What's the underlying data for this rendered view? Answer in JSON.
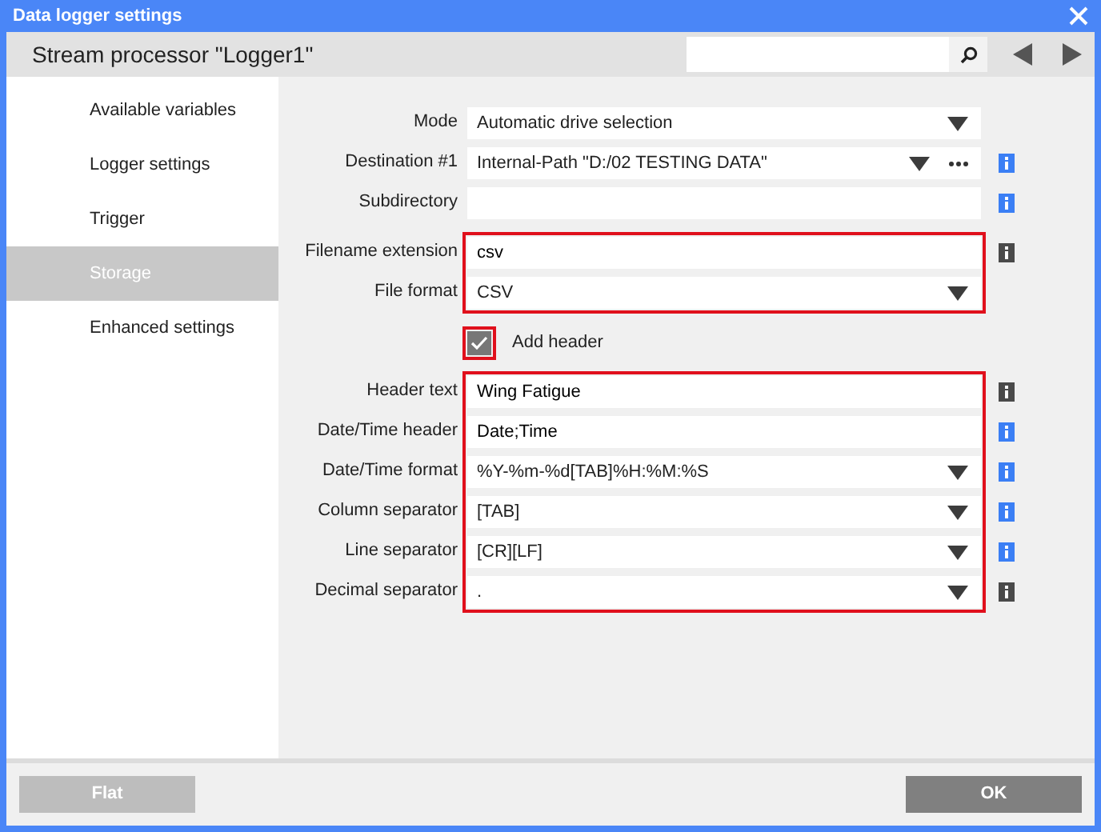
{
  "window": {
    "title": "Data logger settings"
  },
  "header": {
    "title": "Stream processor \"Logger1\""
  },
  "sidebar": {
    "items": [
      {
        "label": "Available variables",
        "selected": false
      },
      {
        "label": "Logger settings",
        "selected": false
      },
      {
        "label": "Trigger",
        "selected": false
      },
      {
        "label": "Storage",
        "selected": true
      },
      {
        "label": "Enhanced settings",
        "selected": false
      }
    ]
  },
  "form": {
    "groups": [
      {
        "rows": [
          {
            "kind": "select",
            "label": "Mode",
            "value": "Automatic drive selection"
          },
          {
            "kind": "browse",
            "label": "Destination #1",
            "value": "Internal-Path \"D:/02 TESTING DATA\"",
            "color": "#3b7ff5"
          },
          {
            "kind": "text",
            "label": "Subdirectory",
            "color": "#3b7ff5"
          }
        ]
      },
      {
        "highlighted": true,
        "rows": [
          {
            "kind": "text",
            "label": "Filename extension",
            "value": "csv",
            "color": "#4a4a4a"
          },
          {
            "kind": "select",
            "label": "File format",
            "value": "CSV"
          }
        ]
      },
      {
        "highlighted": true,
        "rows": [
          {
            "kind": "checkbox",
            "label": "Add header",
            "checked": true
          }
        ]
      },
      {
        "highlighted": true,
        "rows": [
          {
            "kind": "text",
            "label": "Header text",
            "value": "Wing Fatigue",
            "color": "#4a4a4a"
          },
          {
            "kind": "text",
            "label": "Date/Time header",
            "value": "Date;Time",
            "color": "#3b7ff5"
          },
          {
            "kind": "select",
            "label": "Date/Time format",
            "value": "%Y-%m-%d[TAB]%H:%M:%S",
            "color": "#3b7ff5"
          },
          {
            "kind": "select",
            "label": "Column separator",
            "value": "[TAB]",
            "color": "#3b7ff5"
          },
          {
            "kind": "select",
            "label": "Line separator",
            "value": "[CR][LF]",
            "color": "#3b7ff5"
          },
          {
            "kind": "select",
            "label": "Decimal separator",
            "value": ".",
            "color": "#4a4a4a"
          }
        ]
      }
    ]
  },
  "footer": {
    "buttons": [
      {
        "label": "Flat",
        "kind": "secondary"
      },
      {
        "label": "OK",
        "kind": "primary"
      }
    ]
  }
}
